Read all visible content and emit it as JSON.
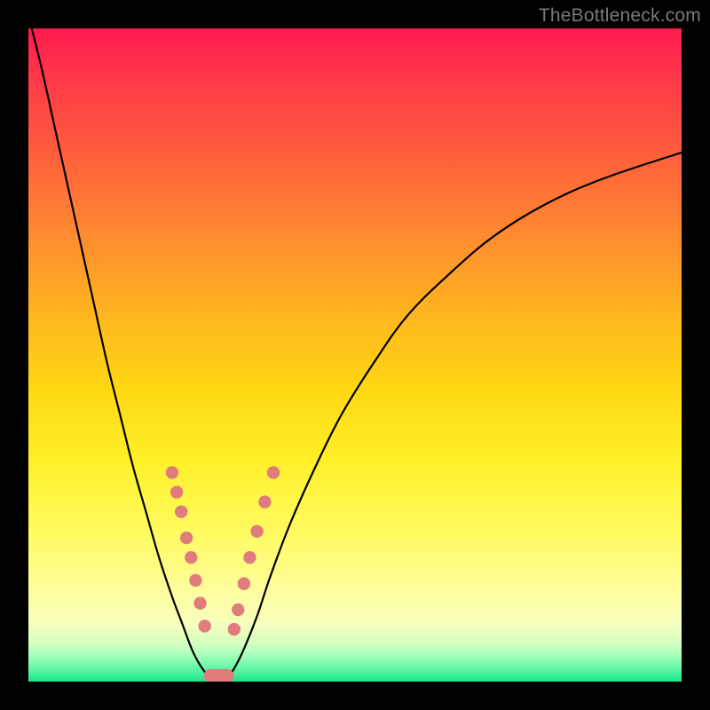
{
  "watermark": "TheBottleneck.com",
  "colors": {
    "frame": "#000000",
    "curve": "#000000",
    "marker": "#e07c7c",
    "gradient_top": "#ff1a4e",
    "gradient_bottom": "#1ae58b"
  },
  "chart_data": {
    "type": "line",
    "title": "",
    "xlabel": "",
    "ylabel": "",
    "xlim": [
      0,
      100
    ],
    "ylim": [
      0,
      100
    ],
    "series": [
      {
        "name": "left-curve",
        "x": [
          0,
          2,
          4,
          6,
          8,
          10,
          12,
          14,
          16,
          18,
          20,
          22,
          23.5,
          25,
          26,
          27,
          27.8
        ],
        "y": [
          102,
          94,
          85,
          76,
          67,
          58,
          49,
          41,
          33,
          26,
          19,
          13,
          9,
          5,
          3,
          1.5,
          0.7
        ]
      },
      {
        "name": "right-curve",
        "x": [
          30.5,
          31.5,
          33,
          35,
          37,
          40,
          44,
          48,
          53,
          58,
          64,
          71,
          79,
          88,
          100
        ],
        "y": [
          0.7,
          2,
          5,
          10,
          16,
          24,
          33,
          41,
          49,
          56,
          62,
          68,
          73,
          77,
          81
        ]
      }
    ],
    "markers": {
      "left_dots": [
        {
          "x": 22.0,
          "y": 32.0
        },
        {
          "x": 22.7,
          "y": 29.0
        },
        {
          "x": 23.4,
          "y": 26.0
        },
        {
          "x": 24.2,
          "y": 22.0
        },
        {
          "x": 24.9,
          "y": 19.0
        },
        {
          "x": 25.6,
          "y": 15.5
        },
        {
          "x": 26.3,
          "y": 12.0
        },
        {
          "x": 27.0,
          "y": 8.5
        }
      ],
      "right_dots": [
        {
          "x": 31.5,
          "y": 8.0
        },
        {
          "x": 32.1,
          "y": 11.0
        },
        {
          "x": 33.0,
          "y": 15.0
        },
        {
          "x": 33.9,
          "y": 19.0
        },
        {
          "x": 35.0,
          "y": 23.0
        },
        {
          "x": 36.2,
          "y": 27.5
        },
        {
          "x": 37.5,
          "y": 32.0
        }
      ],
      "bottom_pill": {
        "x0": 27.8,
        "x1": 30.5,
        "y": 0.9
      }
    },
    "grid": false,
    "legend": false
  }
}
